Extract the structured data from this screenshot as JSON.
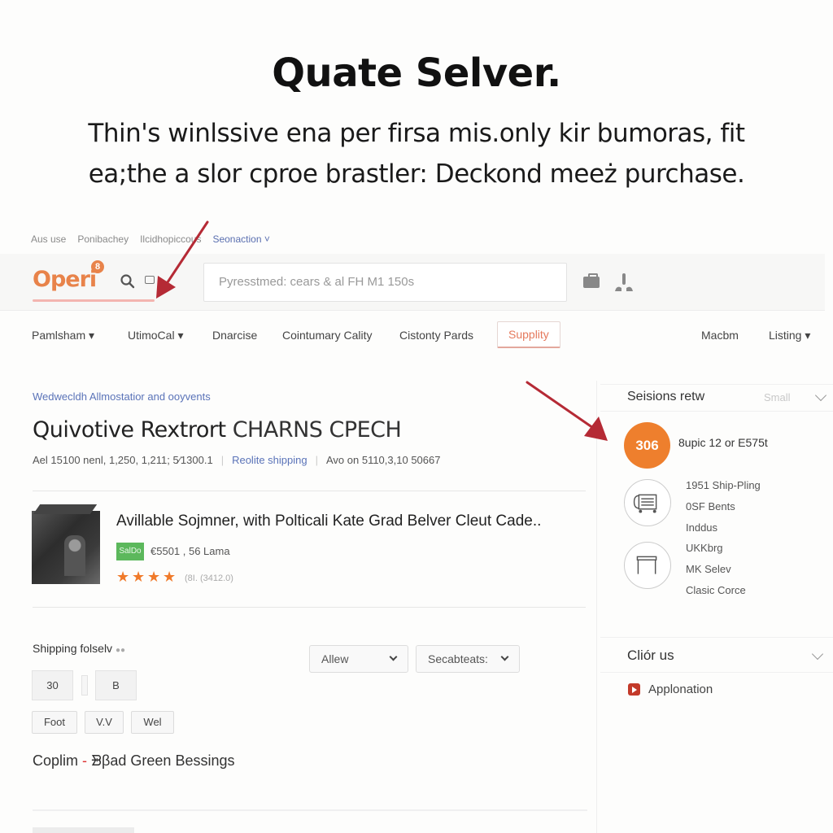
{
  "headline": {
    "title": "Quate Selver.",
    "subtitle_line1": "Thin's winlssive ena per firsa mis.only kir bumoras, fit",
    "subtitle_line2": "ea;the a slor cproe brastler: Deckond meeż purchase."
  },
  "topnav": {
    "items": [
      "Aus use",
      "Ponibachey",
      "Ilcidhopiccous",
      "Seonaction"
    ],
    "active_index": 3
  },
  "header": {
    "logo_text": "Operi",
    "logo_badge": "8",
    "search_placeholder": "Pyresstmed: cears & al FH M1 150s",
    "icons": [
      "search-icon",
      "square-icon",
      "bag-icon",
      "user-icon"
    ]
  },
  "catnav": {
    "items": [
      {
        "label": "Pamlsham ▾"
      },
      {
        "label": "UtimoCal ▾"
      },
      {
        "label": "Dnarcise"
      },
      {
        "label": "Cointumary Cality"
      },
      {
        "label": "Cistonty Pards"
      },
      {
        "label": "Supplity"
      },
      {
        "label": "Macbm"
      },
      {
        "label": "Listing ▾"
      }
    ],
    "active_label": "Supplity"
  },
  "product": {
    "section_link": "Wedwecldh Allmostatior and ooyvents",
    "title_main": "Quivotive Rextrort",
    "title_caps": "CHARNS CPECH",
    "meta_left": "Ael 15100 nenl, 1,250, 1,211; 5⁄1300.1",
    "meta_link": "Reolite shipping",
    "meta_right": "Avo on 5110,3,10 50667"
  },
  "item": {
    "title": "Avillable Sojmner, with Polticali Kate Grad Belver Cleut Cade..",
    "badge": "SalDo",
    "price": "€5501 , 56 Lama",
    "rating": 4,
    "rating_max": 4,
    "reviews": "(8I. (3412.0)"
  },
  "sidebar": {
    "panel_title": "Seisions retw",
    "panel_size": "Small",
    "offer_badge": "306",
    "offer_text": "8upic 12 or E575t",
    "list1": [
      "1951 Ship-Pling",
      "0SF Bents",
      "Inddus"
    ],
    "list2": [
      "UKKbrg",
      "MK Selev",
      "Clasic Corce"
    ],
    "panel2_title": "Cliór us",
    "panel2_item": "Applonation"
  },
  "shipping": {
    "label": "Shipping folselv",
    "dots": "●●",
    "qty_a": "30",
    "qty_b": "B",
    "options": [
      "Foot",
      "V.V",
      "Wel"
    ],
    "dropdown1": "Allew",
    "dropdown2": "Secabteats:",
    "footer_a": "Coplim",
    "footer_sep": "-",
    "footer_b": "ᗾβad Green Bessings"
  },
  "colors": {
    "accent_orange": "#ee7f2d",
    "link_blue": "#5a73b8",
    "badge_green": "#5cb85c",
    "arrow_red": "#b52a35"
  }
}
